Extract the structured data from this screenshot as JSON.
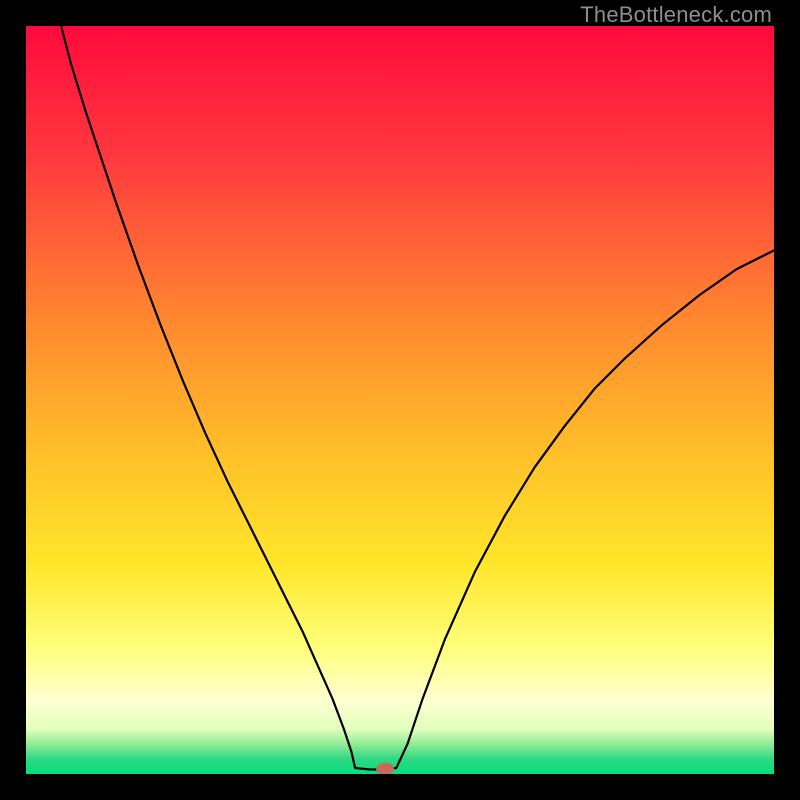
{
  "watermark": "TheBottleneck.com",
  "chart_data": {
    "type": "line",
    "title": "",
    "xlabel": "",
    "ylabel": "",
    "xlim": [
      0,
      100
    ],
    "ylim": [
      0,
      100
    ],
    "background": {
      "gradient_stops": [
        {
          "pos": 0,
          "color": "#ff0a3c"
        },
        {
          "pos": 18,
          "color": "#ff3a3e"
        },
        {
          "pos": 40,
          "color": "#ff8a2f"
        },
        {
          "pos": 58,
          "color": "#ffc229"
        },
        {
          "pos": 72,
          "color": "#ffe62a"
        },
        {
          "pos": 83,
          "color": "#ffff7a"
        },
        {
          "pos": 90,
          "color": "#ffffd0"
        },
        {
          "pos": 94,
          "color": "#e2ffbe"
        },
        {
          "pos": 96,
          "color": "#8fec95"
        },
        {
          "pos": 98,
          "color": "#30d884"
        },
        {
          "pos": 100,
          "color": "#00e07a"
        }
      ]
    },
    "series": [
      {
        "name": "bottleneck-curve",
        "stroke": "#000000",
        "points": [
          {
            "x": 4.7,
            "y": 100.0
          },
          {
            "x": 6.0,
            "y": 95.0
          },
          {
            "x": 8.0,
            "y": 88.5
          },
          {
            "x": 10.0,
            "y": 82.5
          },
          {
            "x": 12.0,
            "y": 76.5
          },
          {
            "x": 15.0,
            "y": 68.0
          },
          {
            "x": 18.0,
            "y": 60.0
          },
          {
            "x": 21.0,
            "y": 52.5
          },
          {
            "x": 24.0,
            "y": 45.5
          },
          {
            "x": 27.0,
            "y": 39.0
          },
          {
            "x": 30.0,
            "y": 33.0
          },
          {
            "x": 33.0,
            "y": 27.0
          },
          {
            "x": 35.0,
            "y": 23.0
          },
          {
            "x": 37.0,
            "y": 19.0
          },
          {
            "x": 39.0,
            "y": 14.5
          },
          {
            "x": 41.0,
            "y": 10.0
          },
          {
            "x": 42.5,
            "y": 6.0
          },
          {
            "x": 43.5,
            "y": 3.0
          },
          {
            "x": 44.0,
            "y": 0.8
          },
          {
            "x": 46.0,
            "y": 0.6
          },
          {
            "x": 48.0,
            "y": 0.6
          },
          {
            "x": 49.5,
            "y": 0.8
          },
          {
            "x": 51.0,
            "y": 4.0
          },
          {
            "x": 53.0,
            "y": 10.0
          },
          {
            "x": 56.0,
            "y": 18.0
          },
          {
            "x": 60.0,
            "y": 27.0
          },
          {
            "x": 64.0,
            "y": 34.5
          },
          {
            "x": 68.0,
            "y": 41.0
          },
          {
            "x": 72.0,
            "y": 46.5
          },
          {
            "x": 76.0,
            "y": 51.5
          },
          {
            "x": 80.0,
            "y": 55.5
          },
          {
            "x": 85.0,
            "y": 60.0
          },
          {
            "x": 90.0,
            "y": 64.0
          },
          {
            "x": 95.0,
            "y": 67.5
          },
          {
            "x": 100.0,
            "y": 70.0
          }
        ]
      }
    ],
    "marker": {
      "name": "optimal-point",
      "x": 48.0,
      "y": 0.7,
      "rx": 1.2,
      "ry": 0.8,
      "fill": "#c76a5b"
    }
  }
}
